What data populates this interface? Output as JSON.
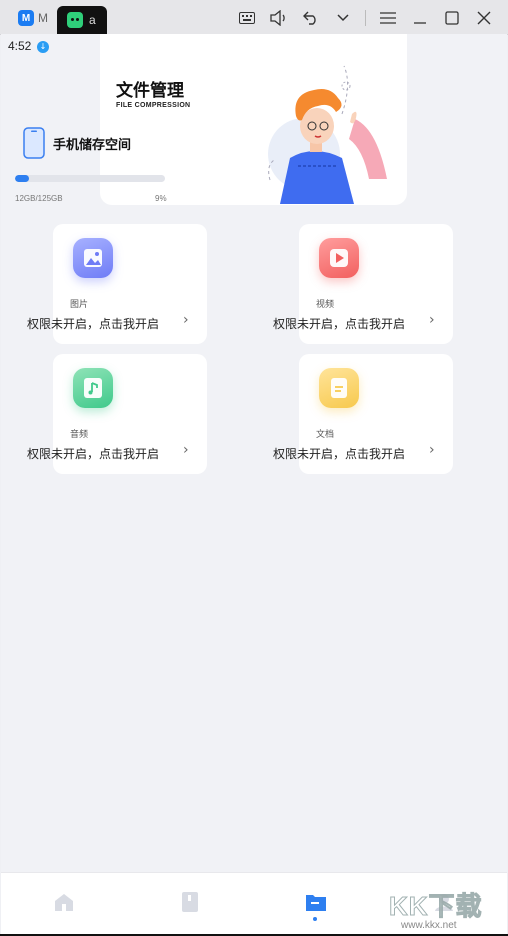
{
  "window": {
    "tab_inactive_letter": "M",
    "tab_active_letter": "a",
    "toolbar_icons": [
      "keyboard-icon",
      "volume-icon",
      "undo-icon",
      "chevron-down-icon",
      "menu-icon",
      "minimize-icon",
      "maximize-icon",
      "close-icon"
    ]
  },
  "status_bar": {
    "time": "4:52"
  },
  "storage": {
    "title": "手机储存空间",
    "used": "12GB/125GB",
    "percent_label": "9%",
    "percent": 9
  },
  "banner": {
    "title": "文件管理",
    "subtitle": "FILE COMPRESSION"
  },
  "categories": [
    {
      "label": "图片",
      "status": "权限未开启，点击我开启",
      "icon": "image-icon",
      "color": "#6f7cf6"
    },
    {
      "label": "视频",
      "status": "权限未开启，点击我开启",
      "icon": "play-icon",
      "color": "#f2605f"
    },
    {
      "label": "音频",
      "status": "权限未开启，点击我开启",
      "icon": "music-icon",
      "color": "#3fc98b"
    },
    {
      "label": "文档",
      "status": "权限未开启，点击我开启",
      "icon": "document-icon",
      "color": "#f7c94d"
    }
  ],
  "bottom_nav": {
    "items": [
      "home-icon",
      "book-icon",
      "folder-icon",
      "profile-icon"
    ],
    "active_index": 2,
    "accent": "#2e7ff0"
  },
  "watermark": {
    "text": "KK下载",
    "url": "www.kkx.net"
  }
}
